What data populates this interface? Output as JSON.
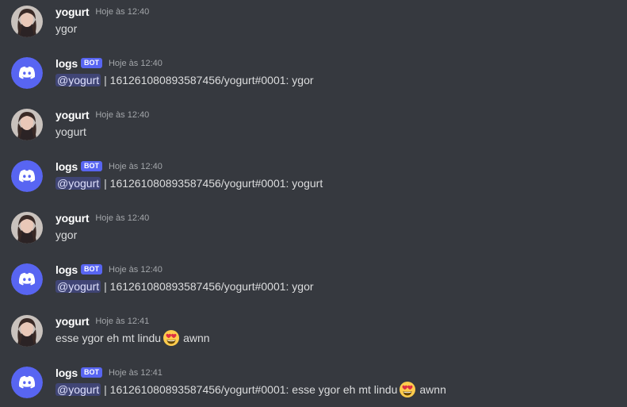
{
  "messages": [
    {
      "author": "yogurt",
      "bot": false,
      "time": "Hoje às 12:40",
      "mention": "",
      "text_before": "ygor",
      "emoji": "",
      "text_after": ""
    },
    {
      "author": "logs",
      "bot": true,
      "bot_label": "BOT",
      "time": "Hoje às 12:40",
      "mention": "@yogurt",
      "text_before": "| 161261080893587456/yogurt#0001: ygor",
      "emoji": "",
      "text_after": ""
    },
    {
      "author": "yogurt",
      "bot": false,
      "time": "Hoje às 12:40",
      "mention": "",
      "text_before": "yogurt",
      "emoji": "",
      "text_after": ""
    },
    {
      "author": "logs",
      "bot": true,
      "bot_label": "BOT",
      "time": "Hoje às 12:40",
      "mention": "@yogurt",
      "text_before": "| 161261080893587456/yogurt#0001: yogurt",
      "emoji": "",
      "text_after": ""
    },
    {
      "author": "yogurt",
      "bot": false,
      "time": "Hoje às 12:40",
      "mention": "",
      "text_before": "ygor",
      "emoji": "",
      "text_after": ""
    },
    {
      "author": "logs",
      "bot": true,
      "bot_label": "BOT",
      "time": "Hoje às 12:40",
      "mention": "@yogurt",
      "text_before": "| 161261080893587456/yogurt#0001: ygor",
      "emoji": "",
      "text_after": ""
    },
    {
      "author": "yogurt",
      "bot": false,
      "time": "Hoje às 12:41",
      "mention": "",
      "text_before": "esse ygor eh mt lindu",
      "emoji": "heart-eyes-emoji",
      "text_after": "awnn"
    },
    {
      "author": "logs",
      "bot": true,
      "bot_label": "BOT",
      "time": "Hoje às 12:41",
      "mention": "@yogurt",
      "text_before": "| 161261080893587456/yogurt#0001: esse ygor eh mt lindu",
      "emoji": "heart-eyes-emoji",
      "text_after": "awnn"
    }
  ],
  "colors": {
    "background": "#36393f",
    "blurple": "#5865f2",
    "timestamp": "#a3a6aa",
    "text": "#dcddde",
    "mention_bg": "rgba(88,101,242,0.3)",
    "mention_text": "#dee0fc"
  },
  "icons": {
    "bot_avatar": "discord-logo-icon",
    "user_avatar": "user-photo-avatar",
    "emoji": "heart-eyes-emoji"
  }
}
